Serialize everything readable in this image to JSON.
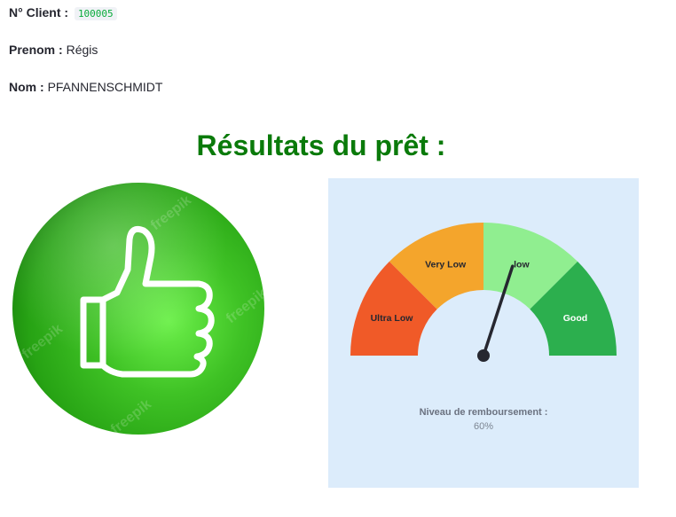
{
  "client": {
    "number_label": "N° Client :",
    "number_value": "100005",
    "prenom_label": "Prenom :",
    "prenom_value": "Régis",
    "nom_label": "Nom :",
    "nom_value": "PFANNENSCHMIDT"
  },
  "results": {
    "title": "Résultats du prêt :",
    "icon": "thumbs-up-icon",
    "icon_watermark": "freepik"
  },
  "gauge": {
    "title": "Niveau de remboursement :",
    "value_text": "60%",
    "value": 60,
    "range": [
      0,
      100
    ],
    "segments": [
      {
        "label": "Ultra Low",
        "from": 0,
        "to": 25,
        "color": "#f05a28",
        "text_color": "#262730"
      },
      {
        "label": "Very Low",
        "from": 25,
        "to": 50,
        "color": "#f4a52c",
        "text_color": "#262730"
      },
      {
        "label": "low",
        "from": 50,
        "to": 75,
        "color": "#90ee90",
        "text_color": "#262730"
      },
      {
        "label": "Good",
        "from": 75,
        "to": 100,
        "color": "#2caf4e",
        "text_color": "#ffffff"
      }
    ],
    "needle_color": "#262730",
    "background_color": "#dcecfb"
  }
}
